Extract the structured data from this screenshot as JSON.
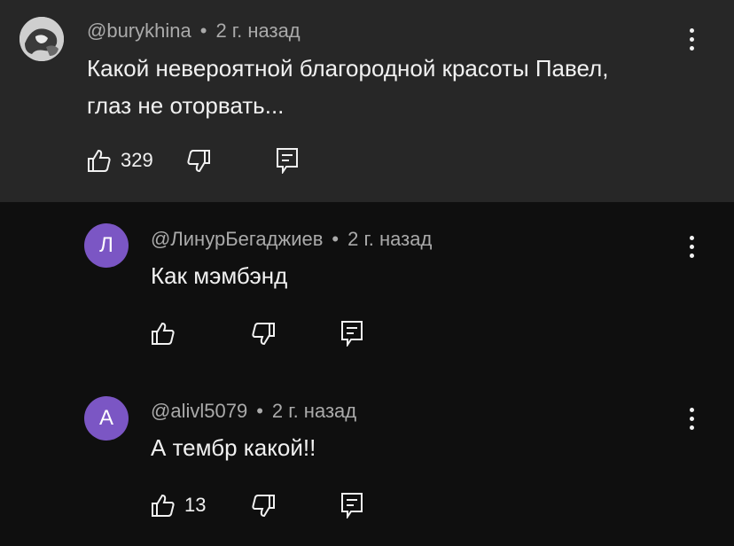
{
  "comments": [
    {
      "author": "@burykhina",
      "time": "2 г. назад",
      "text_line1": "Какой  невероятной благородной красоты Павел,",
      "text_line2": "глаз не оторвать...",
      "likes": "329",
      "avatar": "photo"
    },
    {
      "author": "@ЛинурБегаджиев",
      "time": "2 г. назад",
      "text": "Как мэмбэнд",
      "likes": "",
      "avatar_letter": "Л",
      "avatar_color": "#7b56c4"
    },
    {
      "author": "@alivl5079",
      "time": "2 г. назад",
      "text": "А тембр какой!!",
      "likes": "13",
      "avatar_letter": "A",
      "avatar_color": "#7b56c4"
    }
  ],
  "meta_separator": "•",
  "icons": {
    "like": "thumb-up-icon",
    "dislike": "thumb-down-icon",
    "reply": "reply-icon",
    "more": "more-vert-icon"
  },
  "colors": {
    "highlight_bg": "#272727",
    "page_bg": "#0f0f0f",
    "meta_text": "#aaaaaa",
    "avatar_purple": "#7b56c4"
  }
}
